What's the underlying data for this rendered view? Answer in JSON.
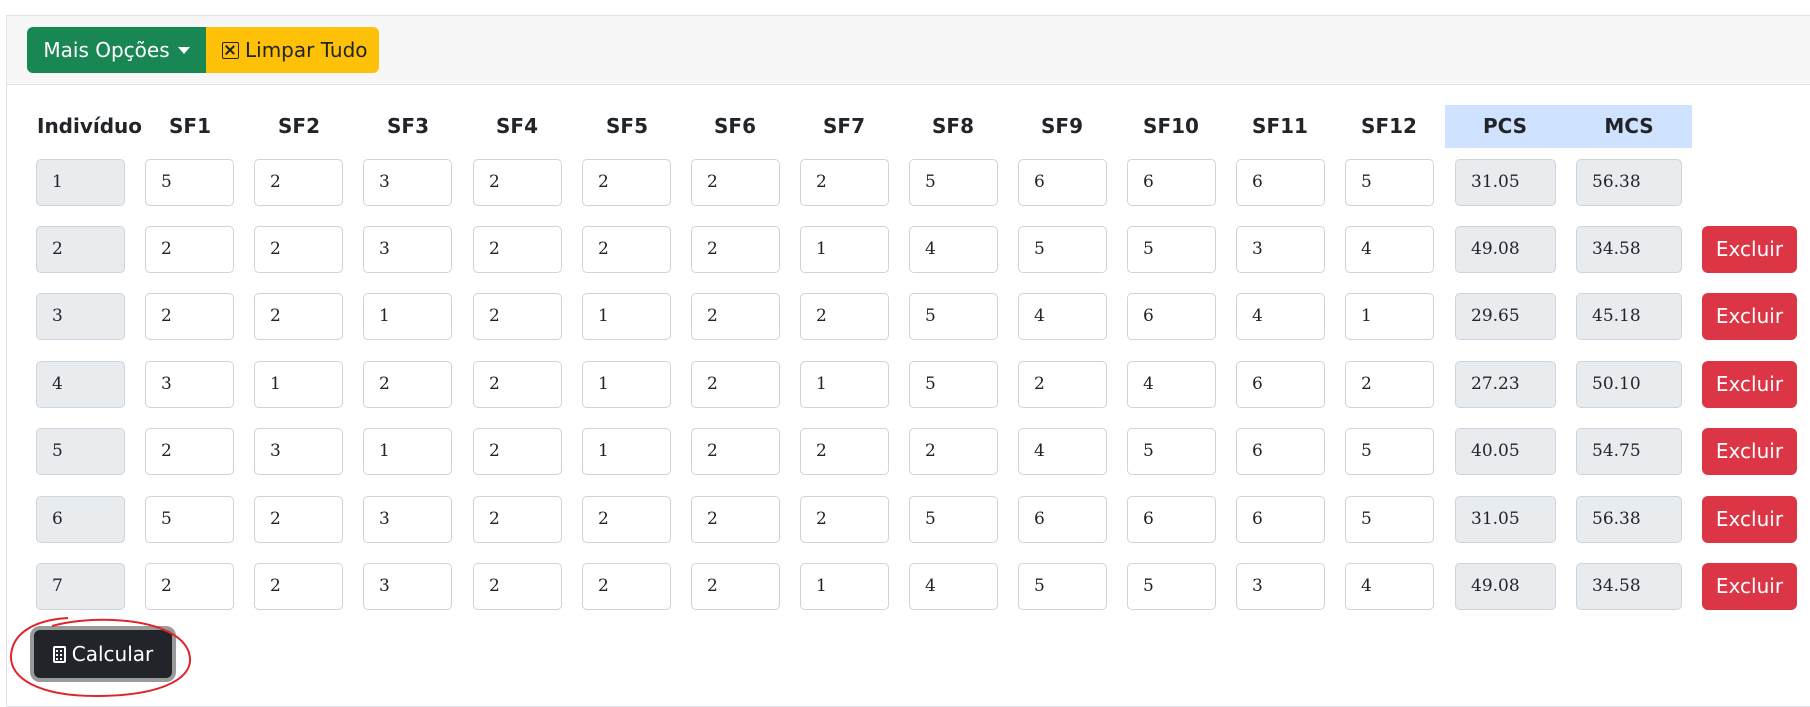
{
  "toolbar": {
    "more_options_label": "Mais Opções",
    "clear_all_label": "Limpar Tudo",
    "caret_icon": "caret-down-icon",
    "clear_icon": "x-square-icon"
  },
  "table": {
    "headers": [
      "Indivíduo",
      "SF1",
      "SF2",
      "SF3",
      "SF4",
      "SF5",
      "SF6",
      "SF7",
      "SF8",
      "SF9",
      "SF10",
      "SF11",
      "SF12",
      "PCS",
      "MCS"
    ],
    "rows": [
      {
        "id": "1",
        "sf": [
          "5",
          "2",
          "3",
          "2",
          "2",
          "2",
          "2",
          "5",
          "6",
          "6",
          "6",
          "5"
        ],
        "pcs": "31.05",
        "mcs": "56.38",
        "delete_label": ""
      },
      {
        "id": "2",
        "sf": [
          "2",
          "2",
          "3",
          "2",
          "2",
          "2",
          "1",
          "4",
          "5",
          "5",
          "3",
          "4"
        ],
        "pcs": "49.08",
        "mcs": "34.58",
        "delete_label": "Excluir"
      },
      {
        "id": "3",
        "sf": [
          "2",
          "2",
          "1",
          "2",
          "1",
          "2",
          "2",
          "5",
          "4",
          "6",
          "4",
          "1"
        ],
        "pcs": "29.65",
        "mcs": "45.18",
        "delete_label": "Excluir"
      },
      {
        "id": "4",
        "sf": [
          "3",
          "1",
          "2",
          "2",
          "1",
          "2",
          "1",
          "5",
          "2",
          "4",
          "6",
          "2"
        ],
        "pcs": "27.23",
        "mcs": "50.10",
        "delete_label": "Excluir"
      },
      {
        "id": "5",
        "sf": [
          "2",
          "3",
          "1",
          "2",
          "1",
          "2",
          "2",
          "2",
          "4",
          "5",
          "6",
          "5"
        ],
        "pcs": "40.05",
        "mcs": "54.75",
        "delete_label": "Excluir"
      },
      {
        "id": "6",
        "sf": [
          "5",
          "2",
          "3",
          "2",
          "2",
          "2",
          "2",
          "5",
          "6",
          "6",
          "6",
          "5"
        ],
        "pcs": "31.05",
        "mcs": "56.38",
        "delete_label": "Excluir"
      },
      {
        "id": "7",
        "sf": [
          "2",
          "2",
          "3",
          "2",
          "2",
          "2",
          "1",
          "4",
          "5",
          "5",
          "3",
          "4"
        ],
        "pcs": "49.08",
        "mcs": "34.58",
        "delete_label": "Excluir"
      }
    ]
  },
  "calculate": {
    "label": "Calcular",
    "icon": "calculator-icon"
  },
  "colors": {
    "green": "#198754",
    "yellow": "#ffc107",
    "red": "#dc3545",
    "dark": "#212529",
    "header_highlight": "#cfe2ff",
    "annotation": "#e0242b"
  }
}
